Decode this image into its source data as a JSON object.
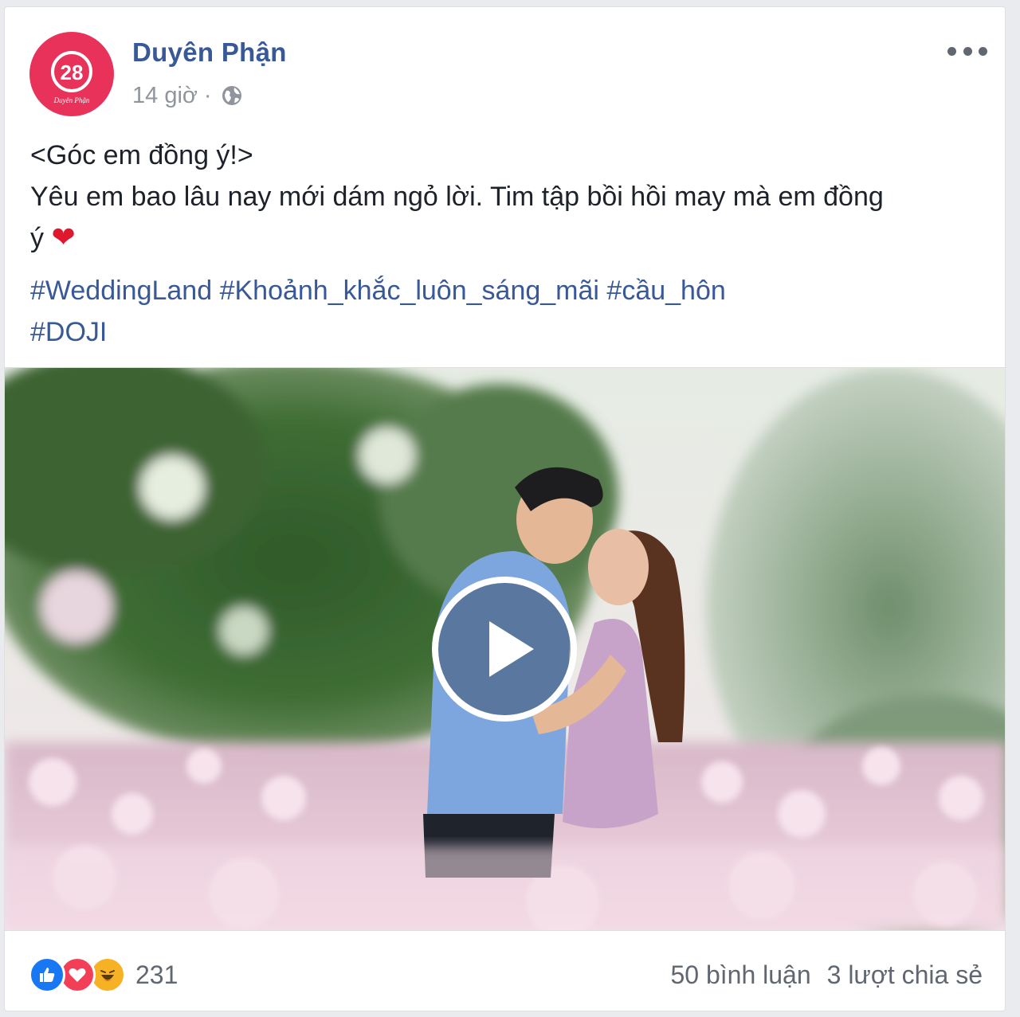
{
  "post": {
    "page_name": "Duyên Phận",
    "time": "14 giờ",
    "separator": "·",
    "privacy_icon": "globe-icon",
    "more_icon": "more-dots-icon",
    "avatar_text": "28",
    "avatar_subtext": "Duyên Phận",
    "avatar_color": "#e8325a",
    "text_line1": "<Góc em đồng ý!>",
    "text_line2": "Yêu em bao lâu nay mới dám ngỏ lời. Tim tập bồi hồi may mà em đồng",
    "text_line3": "ý",
    "heart_emoji": "❤",
    "hashtags": [
      "#WeddingLand",
      "#Khoảnh_khắc_luôn_sáng_mãi",
      "#cầu_hôn",
      "#DOJI"
    ]
  },
  "media": {
    "type": "video",
    "play_icon": "play-icon"
  },
  "footer": {
    "reactions": [
      "like-icon",
      "love-icon",
      "haha-icon"
    ],
    "reaction_count": "231",
    "comments": "50 bình luận",
    "shares": "3 lượt chia sẻ"
  },
  "colors": {
    "link": "#385898",
    "like": "#1877f2",
    "love": "#f33e58",
    "haha": "#f7b125"
  }
}
